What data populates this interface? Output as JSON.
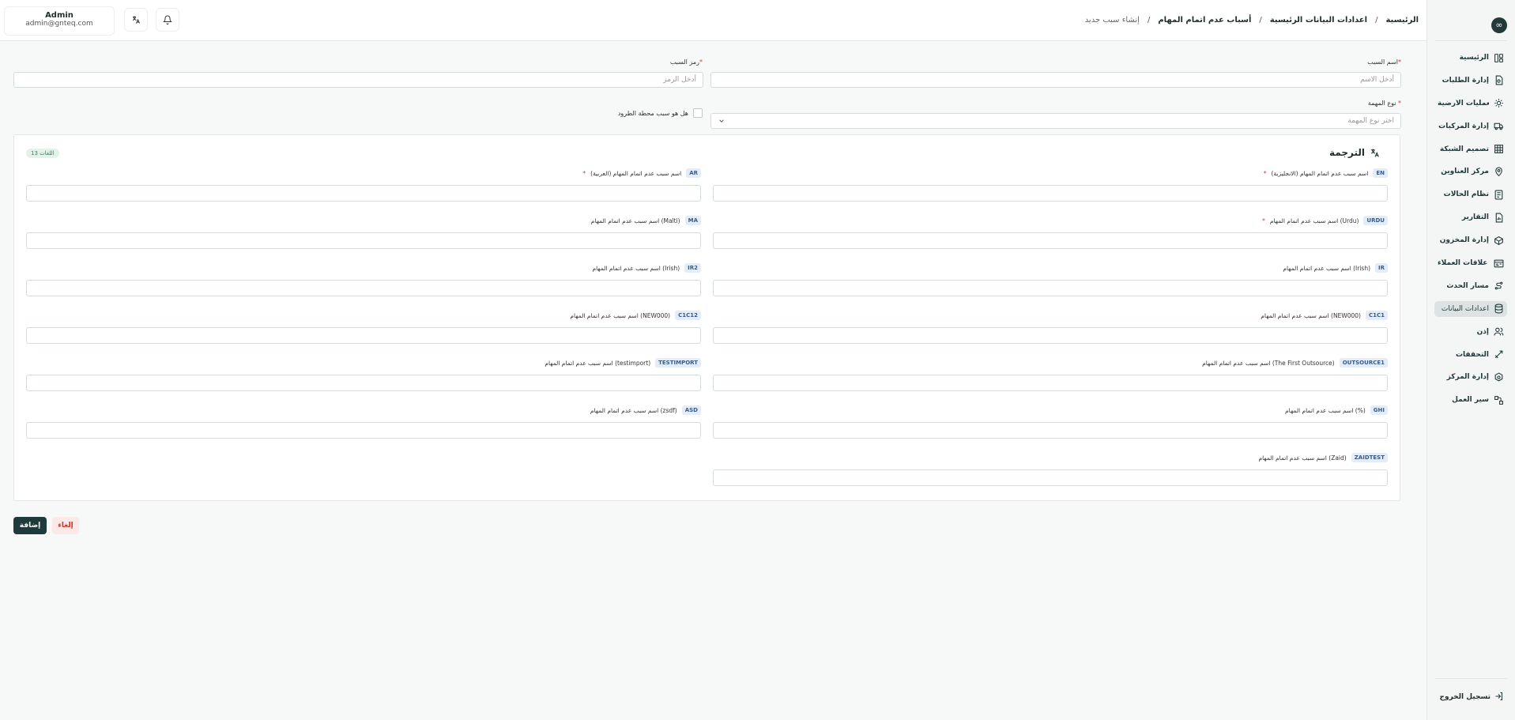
{
  "user": {
    "name": "Admin",
    "email": "admin@gnteq.com"
  },
  "breadcrumb": [
    "الرئيسية",
    "اعدادات البيانات الرئيسية",
    "أسباب عدم اتمام المهام",
    "إنشاء سبب جديد"
  ],
  "sidebar": {
    "logo": "∞",
    "items": [
      {
        "label": "الرئيسية",
        "icon": "home-icon"
      },
      {
        "label": "إدارة الطلبات",
        "icon": "orders-icon"
      },
      {
        "label": "العمليات الارضية",
        "icon": "ground-ops-icon"
      },
      {
        "label": "إدارة المركبات",
        "icon": "truck-icon"
      },
      {
        "label": "تصميم الشبكة",
        "icon": "network-icon"
      },
      {
        "label": "مركز العناوين",
        "icon": "address-icon"
      },
      {
        "label": "نظام الحالات",
        "icon": "status-icon"
      },
      {
        "label": "التقارير",
        "icon": "report-icon"
      },
      {
        "label": "إدارة المخزون",
        "icon": "inventory-icon"
      },
      {
        "label": "إدارة علاقات العملاء",
        "icon": "crm-icon"
      },
      {
        "label": "مسار الحدث",
        "icon": "route-icon"
      },
      {
        "label": "اعدادات البيانات",
        "icon": "database-icon",
        "active": true
      },
      {
        "label": "إذن",
        "icon": "users-icon"
      },
      {
        "label": "التحققات",
        "icon": "validations-icon"
      },
      {
        "label": "إدارة المركز",
        "icon": "hub-icon"
      },
      {
        "label": "سير العمل",
        "icon": "workflow-icon"
      }
    ],
    "logout": "تسجيل الخروج"
  },
  "form": {
    "name_label": "اسم السبب",
    "name_placeholder": "أدخل الاسم",
    "code_label": "رمز السبب",
    "code_placeholder": "أدخل الرمز",
    "task_type_label": "نوع المهمة",
    "task_type_placeholder": "اختر نوع المهمة",
    "checkbox_label": "هل هو سبب محطة الطرود"
  },
  "translation": {
    "title": "الترجمة",
    "badge": "13 اللغات",
    "fields": [
      {
        "code": "EN",
        "label": "اسم سبب عدم اتمام المهام (الانجليزية)",
        "required": true
      },
      {
        "code": "AR",
        "label": "اسم سبب عدم اتمام المهام (العربية)",
        "required": true
      },
      {
        "code": "URDU",
        "label": "اسم سبب عدم اتمام المهام (Urdu)",
        "required": true
      },
      {
        "code": "MA",
        "label": "اسم سبب عدم اتمام المهام (Malti)",
        "required": false
      },
      {
        "code": "IR",
        "label": "اسم سبب عدم اتمام المهام (Irish)",
        "required": false
      },
      {
        "code": "IR2",
        "label": "اسم سبب عدم اتمام المهام (Irish)",
        "required": false
      },
      {
        "code": "C1C1",
        "label": "اسم سبب عدم اتمام المهام (NEW000)",
        "required": false
      },
      {
        "code": "C1C12",
        "label": "اسم سبب عدم اتمام المهام (NEW000)",
        "required": false
      },
      {
        "code": "OUTSOURCE1",
        "label": "اسم سبب عدم اتمام المهام (The First Outsource)",
        "required": false
      },
      {
        "code": "TESTIMPORT",
        "label": "اسم سبب عدم اتمام المهام (testimport)",
        "required": false
      },
      {
        "code": "GHI",
        "label": "اسم سبب عدم اتمام المهام (%)",
        "required": false
      },
      {
        "code": "ASD",
        "label": "اسم سبب عدم اتمام المهام (zsdf)",
        "required": false
      },
      {
        "code": "ZAIDTEST",
        "label": "اسم سبب عدم اتمام المهام (Zaid)",
        "required": false
      }
    ]
  },
  "buttons": {
    "add": "إضافة",
    "cancel": "إلغاء"
  }
}
